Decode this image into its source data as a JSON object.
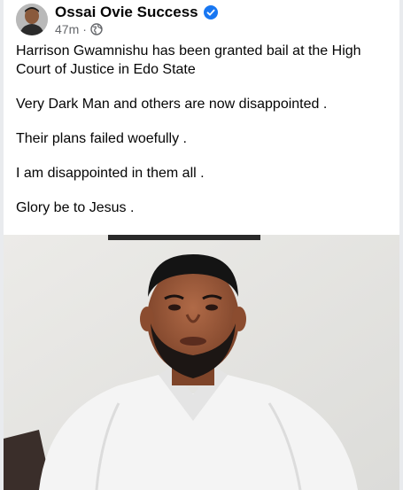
{
  "post": {
    "author_name": "Ossai Ovie Success",
    "timestamp": "47m",
    "separator": "·",
    "privacy_icon": "globe-icon",
    "verified_icon": "verified-badge-icon",
    "paragraphs": [
      "Harrison Gwamnishu has been granted bail at the High Court of Justice in Edo State",
      "Very Dark Man and others are now disappointed .",
      "Their plans failed woefully .",
      "I am disappointed in them all .",
      "Glory be to Jesus ."
    ]
  },
  "colors": {
    "verified_blue": "#1877f2",
    "meta_gray": "#65676b",
    "text": "#050505",
    "photo_background": "#e6e6e4",
    "shirt": "#f4f4f4"
  }
}
